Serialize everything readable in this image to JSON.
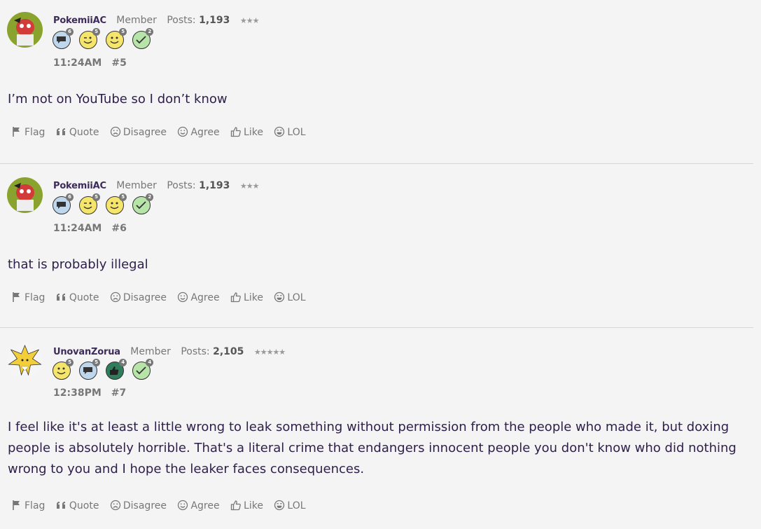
{
  "posts": [
    {
      "username": "PokemiiAC",
      "role": "Member",
      "posts_label": "Posts:",
      "post_count": "1,193",
      "stars": "★★★",
      "badges": [
        {
          "type": "chat",
          "level": "6"
        },
        {
          "type": "wink",
          "level": "5"
        },
        {
          "type": "smile",
          "level": "5"
        },
        {
          "type": "check",
          "level": "2"
        }
      ],
      "time": "11:24AM",
      "number": "#5",
      "content": "I’m not on YouTube so I don’t know"
    },
    {
      "username": "PokemiiAC",
      "role": "Member",
      "posts_label": "Posts:",
      "post_count": "1,193",
      "stars": "★★★",
      "badges": [
        {
          "type": "chat",
          "level": "6"
        },
        {
          "type": "wink",
          "level": "5"
        },
        {
          "type": "smile",
          "level": "5"
        },
        {
          "type": "check",
          "level": "2"
        }
      ],
      "time": "11:24AM",
      "number": "#6",
      "content": "that is probably illegal"
    },
    {
      "username": "UnovanZorua",
      "role": "Member",
      "posts_label": "Posts:",
      "post_count": "2,105",
      "stars": "★★★★★",
      "badges": [
        {
          "type": "smile",
          "level": "5"
        },
        {
          "type": "chat",
          "level": "5"
        },
        {
          "type": "thumb",
          "level": "4"
        },
        {
          "type": "check",
          "level": "4"
        }
      ],
      "time": "12:38PM",
      "number": "#7",
      "content": "I feel like it's at least a little wrong to leak something without permission from the people who made it, but doxing people is absolutely horrible. That's a literal crime that endangers innocent people you don't know who did nothing wrong to you and I hope the leaker faces consequences."
    }
  ],
  "actions": {
    "flag": "Flag",
    "quote": "Quote",
    "disagree": "Disagree",
    "agree": "Agree",
    "like": "Like",
    "lol": "LOL"
  },
  "colors": {
    "background": "#f4f4f4",
    "username": "#3d2b5a",
    "content_text": "#2d1f4a",
    "muted": "#777777",
    "divider": "#d6d6d6"
  }
}
